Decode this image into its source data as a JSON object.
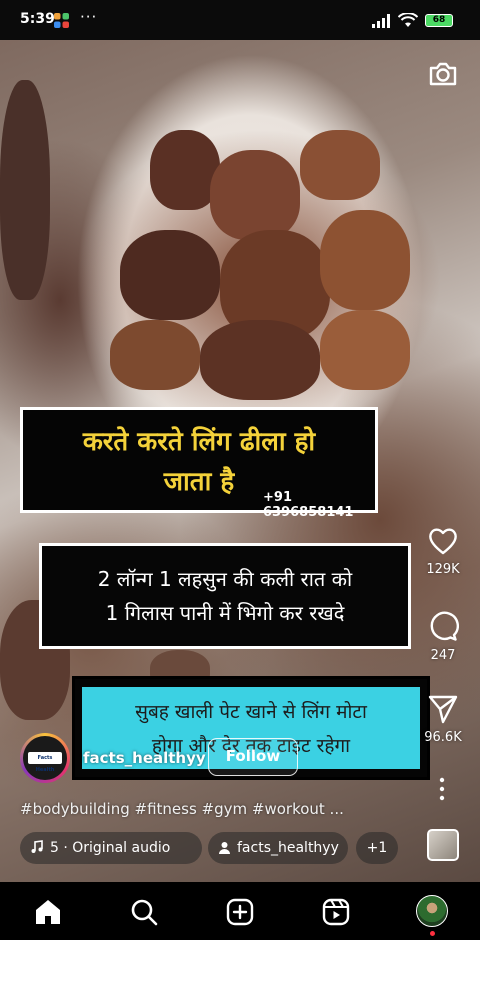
{
  "status_bar": {
    "time": "5:39",
    "dots": "···",
    "battery": "68"
  },
  "reel": {
    "overlay_line1": "करते करते लिंग ढीला हो",
    "overlay_line2": "जाता है",
    "overlay_phone": "+91 6396858141",
    "box2_line1": "2 लॉन्ग 1 लहसुन की कली रात को",
    "box2_line2": "1 गिलास पानी में भिगो कर रखदे",
    "box3_line1": "सुबह खाली पेट खाने से लिंग मोटा",
    "box3_line2": "होगा और देर तक टाइट रहेगा"
  },
  "actions": {
    "likes": "129K",
    "comments": "247",
    "shares": "96.6K"
  },
  "author": {
    "avatar_badge": "Facts Health",
    "username": "facts_healthyy",
    "follow_label": "Follow"
  },
  "caption": {
    "hashtags": "#bodybuilding #fitness #gym #workout ..."
  },
  "chips": {
    "audio_label": "5 · Original audio",
    "audio_icon": "music-note-icon",
    "user_label": "facts_healthyy",
    "user_icon": "person-icon",
    "more_label": "+1"
  },
  "nav": {
    "items": [
      "home-icon",
      "search-icon",
      "create-icon",
      "reels-icon",
      "profile-avatar"
    ]
  },
  "colors": {
    "overlay_yellow": "#f4d23a",
    "cyan_box": "#3bd1e3",
    "notification_dot": "#ff3040"
  }
}
